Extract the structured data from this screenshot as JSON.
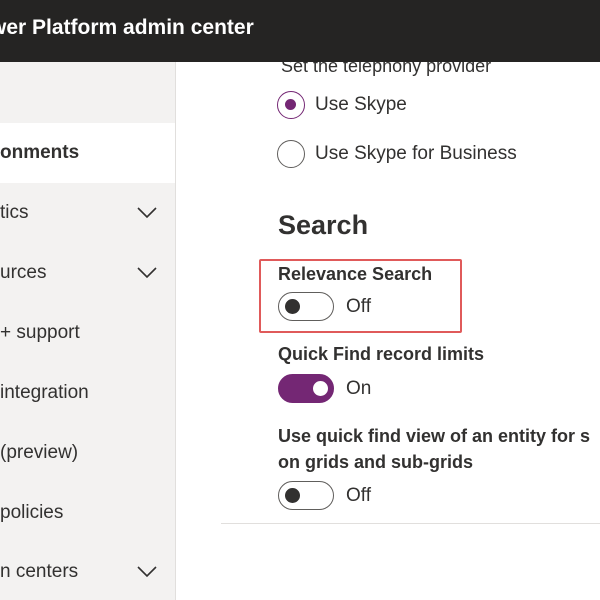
{
  "header": {
    "app_title": "wer Platform admin center",
    "background": "#252423"
  },
  "sidebar": {
    "items": [
      {
        "label": "onments",
        "selected": true,
        "expandable": false
      },
      {
        "label": "tics",
        "selected": false,
        "expandable": true
      },
      {
        "label": "urces",
        "selected": false,
        "expandable": true
      },
      {
        "label": "+ support",
        "selected": false,
        "expandable": false
      },
      {
        "label": "integration",
        "selected": false,
        "expandable": false
      },
      {
        "label": "(preview)",
        "selected": false,
        "expandable": false
      },
      {
        "label": "policies",
        "selected": false,
        "expandable": false
      },
      {
        "label": "n centers",
        "selected": false,
        "expandable": true
      }
    ]
  },
  "main": {
    "cutoff_text": "Set the telephony provider",
    "telephony_options": [
      {
        "label": "Use Skype",
        "checked": true
      },
      {
        "label": "Use Skype for Business",
        "checked": false
      }
    ],
    "search_section": {
      "title": "Search",
      "relevance_search": {
        "label": "Relevance Search",
        "state": "Off",
        "on": false
      },
      "quick_find_limits": {
        "label": "Quick Find record limits",
        "state": "On",
        "on": true
      },
      "quick_find_view": {
        "label_line1": "Use quick find view of an entity for s",
        "label_line2": "on grids and sub-grids",
        "state": "Off",
        "on": false
      }
    }
  },
  "colors": {
    "accent": "#742774",
    "highlight_border": "#e05a5a",
    "sidebar_bg": "#f3f2f1"
  }
}
